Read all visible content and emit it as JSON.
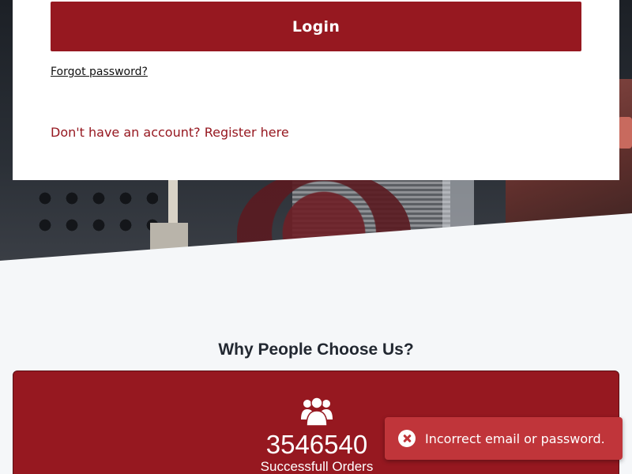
{
  "login": {
    "button_label": "Login",
    "forgot_password": "Forgot password?",
    "register_prompt": "Don't have an account? Register here"
  },
  "why_choose": {
    "title": "Why People Choose Us?",
    "stat": {
      "icon": "users-icon",
      "value": "3546540",
      "label": "Successfull Orders"
    }
  },
  "toast": {
    "icon": "error-circle-icon",
    "message": "Incorrect email or password."
  },
  "colors": {
    "brand": "#961820",
    "toast_error": "#c0353a",
    "page_bg": "#f5f7f9"
  }
}
